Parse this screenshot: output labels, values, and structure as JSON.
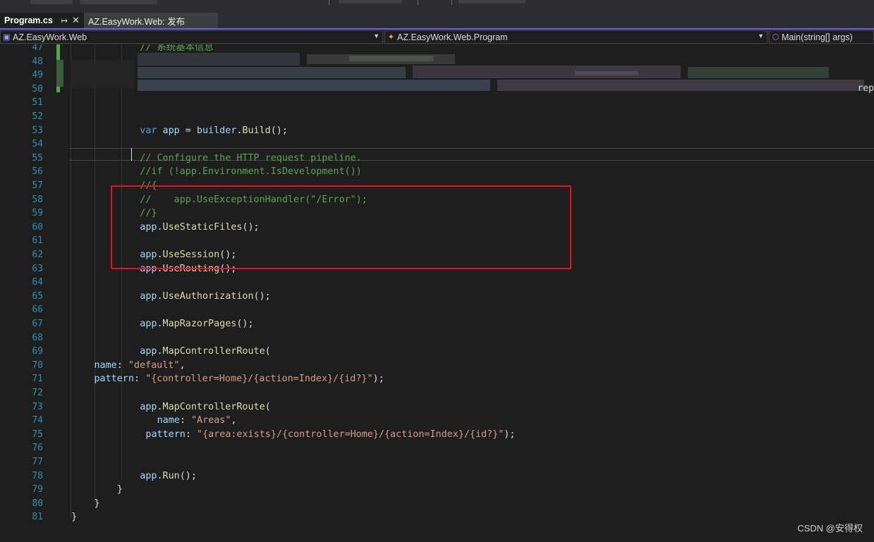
{
  "tabs": [
    {
      "label": "Program.cs",
      "pin": "↦",
      "close": "✕",
      "active": true
    },
    {
      "label": "AZ.EasyWork.Web: 发布",
      "active": false
    }
  ],
  "navbar": {
    "project": "AZ.EasyWork.Web",
    "class": "AZ.EasyWork.Web.Program",
    "member": "Main(string[] args)"
  },
  "editor": {
    "lines": [
      {
        "n": "47",
        "indent": 23,
        "tokens": [
          {
            "t": "cm",
            "v": "// 系统基本信息"
          }
        ]
      },
      {
        "n": "48",
        "indent": 23,
        "tokens": []
      },
      {
        "n": "49",
        "indent": 23,
        "tokens": []
      },
      {
        "n": "50",
        "indent": 23,
        "tokens": []
      },
      {
        "n": "51",
        "indent": 23,
        "tokens": []
      },
      {
        "n": "52",
        "indent": 23,
        "tokens": []
      },
      {
        "n": "53",
        "indent": 23,
        "tokens": [
          {
            "t": "kw",
            "v": "var "
          },
          {
            "t": "id",
            "v": "app"
          },
          {
            "t": "pl",
            "v": " = "
          },
          {
            "t": "id",
            "v": "builder"
          },
          {
            "t": "pl",
            "v": "."
          },
          {
            "t": "fn",
            "v": "Build"
          },
          {
            "t": "pl",
            "v": "();"
          }
        ]
      },
      {
        "n": "54",
        "indent": 23,
        "tokens": []
      },
      {
        "n": "55",
        "indent": 23,
        "tokens": [
          {
            "t": "cm",
            "v": "// Configure the HTTP request pipeline."
          }
        ]
      },
      {
        "n": "56",
        "indent": 23,
        "tokens": [
          {
            "t": "cm",
            "v": "//if (!app.Environment.IsDevelopment())"
          }
        ]
      },
      {
        "n": "57",
        "indent": 23,
        "tokens": [
          {
            "t": "cm",
            "v": "//{"
          }
        ]
      },
      {
        "n": "58",
        "indent": 23,
        "tokens": [
          {
            "t": "cm",
            "v": "//    app.UseExceptionHandler(\"/Error\");"
          }
        ]
      },
      {
        "n": "59",
        "indent": 23,
        "tokens": [
          {
            "t": "cm",
            "v": "//}"
          }
        ]
      },
      {
        "n": "60",
        "indent": 23,
        "tokens": [
          {
            "t": "id",
            "v": "app"
          },
          {
            "t": "pl",
            "v": "."
          },
          {
            "t": "fn",
            "v": "UseStaticFiles"
          },
          {
            "t": "pl",
            "v": "();"
          }
        ]
      },
      {
        "n": "61",
        "indent": 23,
        "tokens": []
      },
      {
        "n": "62",
        "indent": 23,
        "tokens": [
          {
            "t": "id",
            "v": "app"
          },
          {
            "t": "pl",
            "v": "."
          },
          {
            "t": "fn",
            "v": "UseSession"
          },
          {
            "t": "pl",
            "v": "();"
          }
        ]
      },
      {
        "n": "63",
        "indent": 23,
        "tokens": [
          {
            "t": "id",
            "v": "app"
          },
          {
            "t": "pl",
            "v": "."
          },
          {
            "t": "fn",
            "v": "UseRouting"
          },
          {
            "t": "pl",
            "v": "();"
          }
        ]
      },
      {
        "n": "64",
        "indent": 23,
        "tokens": []
      },
      {
        "n": "65",
        "indent": 23,
        "tokens": [
          {
            "t": "id",
            "v": "app"
          },
          {
            "t": "pl",
            "v": "."
          },
          {
            "t": "fn",
            "v": "UseAuthorization"
          },
          {
            "t": "pl",
            "v": "();"
          }
        ]
      },
      {
        "n": "66",
        "indent": 23,
        "tokens": []
      },
      {
        "n": "67",
        "indent": 23,
        "tokens": [
          {
            "t": "id",
            "v": "app"
          },
          {
            "t": "pl",
            "v": "."
          },
          {
            "t": "fn",
            "v": "MapRazorPages"
          },
          {
            "t": "pl",
            "v": "();"
          }
        ]
      },
      {
        "n": "68",
        "indent": 23,
        "tokens": []
      },
      {
        "n": "69",
        "indent": 23,
        "tokens": [
          {
            "t": "id",
            "v": "app"
          },
          {
            "t": "pl",
            "v": "."
          },
          {
            "t": "fn",
            "v": "MapControllerRoute"
          },
          {
            "t": "pl",
            "v": "("
          }
        ]
      },
      {
        "n": "70",
        "indent": 15,
        "tokens": [
          {
            "t": "id",
            "v": "name"
          },
          {
            "t": "pl",
            "v": ": "
          },
          {
            "t": "st",
            "v": "\"default\""
          },
          {
            "t": "pl",
            "v": ","
          }
        ]
      },
      {
        "n": "71",
        "indent": 15,
        "tokens": [
          {
            "t": "id",
            "v": "pattern"
          },
          {
            "t": "pl",
            "v": ": "
          },
          {
            "t": "st",
            "v": "\"{controller=Home}/{action=Index}/{id?}\""
          },
          {
            "t": "pl",
            "v": ");"
          }
        ]
      },
      {
        "n": "72",
        "indent": 23,
        "tokens": []
      },
      {
        "n": "73",
        "indent": 23,
        "tokens": [
          {
            "t": "id",
            "v": "app"
          },
          {
            "t": "pl",
            "v": "."
          },
          {
            "t": "fn",
            "v": "MapControllerRoute"
          },
          {
            "t": "pl",
            "v": "("
          }
        ]
      },
      {
        "n": "74",
        "indent": 26,
        "tokens": [
          {
            "t": "id",
            "v": "name"
          },
          {
            "t": "pl",
            "v": ": "
          },
          {
            "t": "st",
            "v": "\"Areas\""
          },
          {
            "t": "pl",
            "v": ","
          }
        ]
      },
      {
        "n": "75",
        "indent": 24,
        "tokens": [
          {
            "t": "id",
            "v": "pattern"
          },
          {
            "t": "pl",
            "v": ": "
          },
          {
            "t": "st",
            "v": "\"{area:exists}/{controller=Home}/{action=Index}/{id?}\""
          },
          {
            "t": "pl",
            "v": ");"
          }
        ]
      },
      {
        "n": "76",
        "indent": 23,
        "tokens": []
      },
      {
        "n": "77",
        "indent": 23,
        "tokens": []
      },
      {
        "n": "78",
        "indent": 23,
        "tokens": [
          {
            "t": "id",
            "v": "app"
          },
          {
            "t": "pl",
            "v": "."
          },
          {
            "t": "fn",
            "v": "Run"
          },
          {
            "t": "pl",
            "v": "();"
          }
        ]
      },
      {
        "n": "79",
        "indent": 19,
        "tokens": [
          {
            "t": "pl",
            "v": "}"
          }
        ]
      },
      {
        "n": "80",
        "indent": 15,
        "tokens": [
          {
            "t": "pl",
            "v": "}"
          }
        ]
      },
      {
        "n": "81",
        "indent": 11,
        "tokens": [
          {
            "t": "pl",
            "v": "}"
          }
        ]
      }
    ],
    "overflow_text": "rep"
  },
  "watermark": "CSDN @安得权"
}
